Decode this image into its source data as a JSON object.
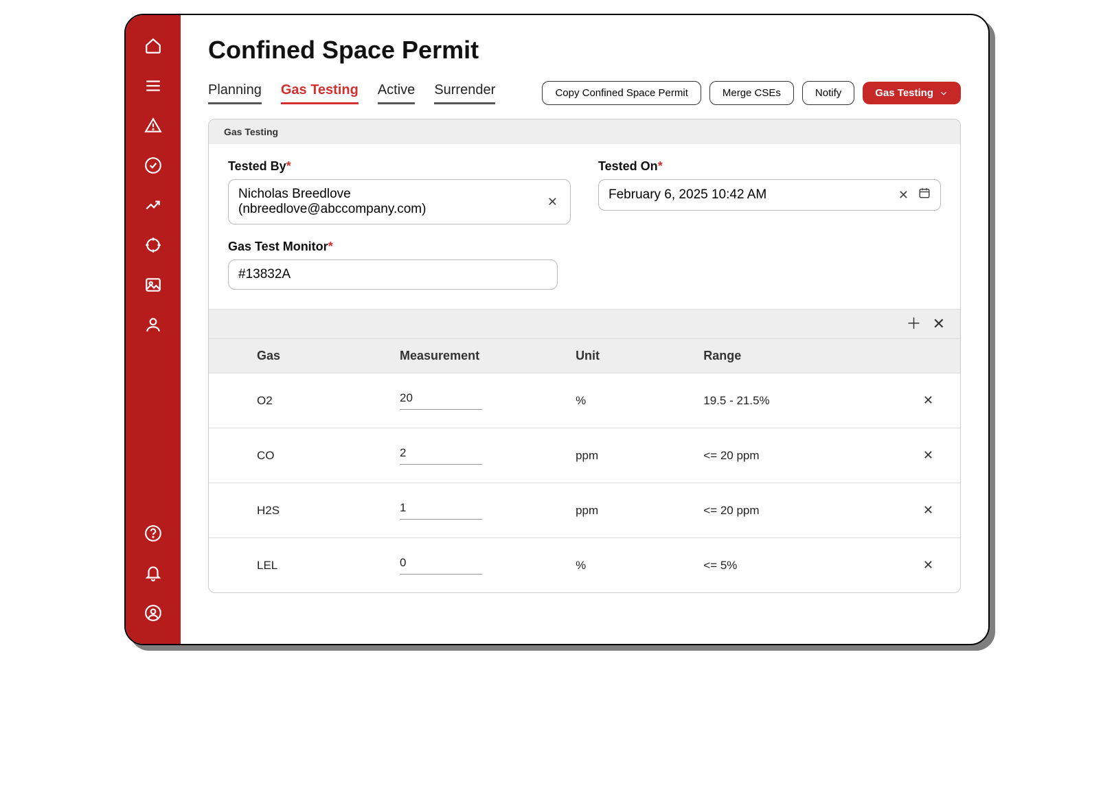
{
  "page": {
    "title": "Confined Space Permit"
  },
  "tabs": [
    "Planning",
    "Gas Testing",
    "Active",
    "Surrender"
  ],
  "active_tab": 1,
  "actions": {
    "copy": "Copy Confined Space Permit",
    "merge": "Merge CSEs",
    "notify": "Notify",
    "primary": "Gas Testing"
  },
  "panel": {
    "title": "Gas Testing",
    "fields": {
      "tested_by": {
        "label": "Tested By",
        "required": true,
        "value": "Nicholas Breedlove (nbreedlove@abccompany.com)"
      },
      "tested_on": {
        "label": "Tested On",
        "required": true,
        "value": "February 6, 2025 10:42 AM"
      },
      "monitor": {
        "label": "Gas Test Monitor",
        "required": true,
        "value": "#13832A"
      }
    }
  },
  "table": {
    "headers": {
      "gas": "Gas",
      "measurement": "Measurement",
      "unit": "Unit",
      "range": "Range"
    },
    "rows": [
      {
        "gas": "O2",
        "measurement": "20",
        "unit": "%",
        "range": "19.5 - 21.5%"
      },
      {
        "gas": "CO",
        "measurement": "2",
        "unit": "ppm",
        "range": "<= 20 ppm"
      },
      {
        "gas": "H2S",
        "measurement": "1",
        "unit": "ppm",
        "range": "<= 20 ppm"
      },
      {
        "gas": "LEL",
        "measurement": "0",
        "unit": "%",
        "range": "<= 5%"
      }
    ]
  }
}
